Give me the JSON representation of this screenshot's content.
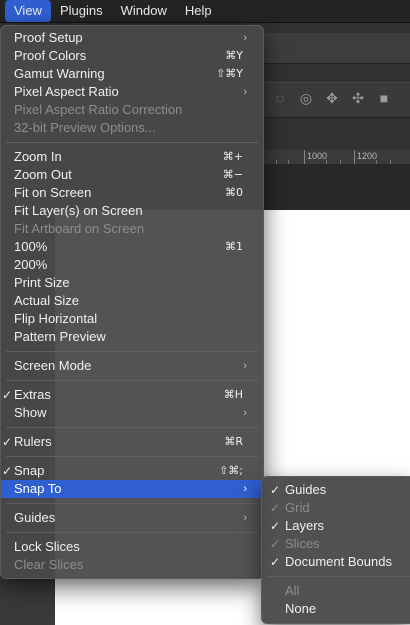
{
  "menubar": [
    {
      "label": "View",
      "active": true
    },
    {
      "label": "Plugins"
    },
    {
      "label": "Window"
    },
    {
      "label": "Help"
    }
  ],
  "ruler": {
    "labels": [
      "1000",
      "1200"
    ]
  },
  "view_menu": {
    "items": [
      {
        "label": "Proof Setup",
        "arrow": true
      },
      {
        "label": "Proof Colors",
        "shortcut": "⌘Y"
      },
      {
        "label": "Gamut Warning",
        "shortcut": "⇧⌘Y"
      },
      {
        "label": "Pixel Aspect Ratio",
        "arrow": true
      },
      {
        "label": "Pixel Aspect Ratio Correction",
        "disabled": true
      },
      {
        "label": "32-bit Preview Options...",
        "disabled": true
      },
      {
        "label": "Zoom In",
        "shortcut": "⌘+"
      },
      {
        "label": "Zoom Out",
        "shortcut": "⌘−"
      },
      {
        "label": "Fit on Screen",
        "shortcut": "⌘0"
      },
      {
        "label": "Fit Layer(s) on Screen"
      },
      {
        "label": "Fit Artboard on Screen",
        "disabled": true
      },
      {
        "label": "100%",
        "shortcut": "⌘1"
      },
      {
        "label": "200%"
      },
      {
        "label": "Print Size"
      },
      {
        "label": "Actual Size"
      },
      {
        "label": "Flip Horizontal"
      },
      {
        "label": "Pattern Preview"
      },
      {
        "label": "Screen Mode",
        "arrow": true
      },
      {
        "label": "Extras",
        "checked": true,
        "shortcut": "⌘H"
      },
      {
        "label": "Show",
        "arrow": true
      },
      {
        "label": "Rulers",
        "checked": true,
        "shortcut": "⌘R"
      },
      {
        "label": "Snap",
        "checked": true,
        "shortcut": "⇧⌘;"
      },
      {
        "label": "Snap To",
        "arrow": true,
        "highlighted": true
      },
      {
        "label": "Guides",
        "arrow": true
      },
      {
        "label": "Lock Slices"
      },
      {
        "label": "Clear Slices",
        "disabled": true
      }
    ]
  },
  "snap_to_submenu": {
    "items": [
      {
        "label": "Guides",
        "checked": true
      },
      {
        "label": "Grid",
        "checked": true,
        "disabled": true
      },
      {
        "label": "Layers",
        "checked": true
      },
      {
        "label": "Slices",
        "checked": true,
        "disabled": true
      },
      {
        "label": "Document Bounds",
        "checked": true
      },
      {
        "label": "All",
        "disabled": true
      },
      {
        "label": "None"
      }
    ]
  },
  "glyphs": {
    "check": "✓",
    "arrow": "›"
  },
  "colors": {
    "highlight": "#2f5fd0",
    "menu_bg": "#484848",
    "disabled_text": "#8d8d8d"
  }
}
